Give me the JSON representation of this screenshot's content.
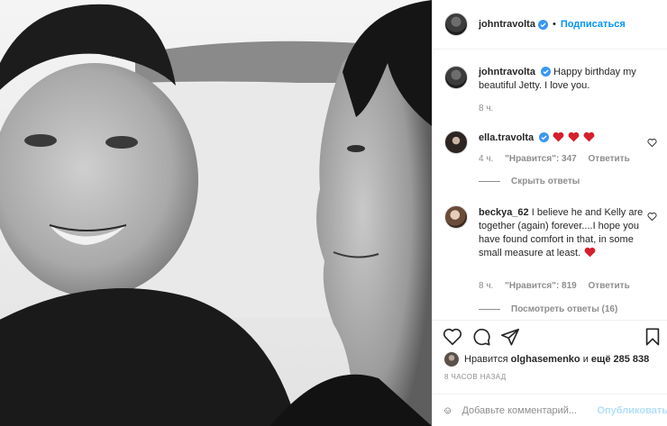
{
  "post": {
    "author": "johntravolta",
    "follow_label": "Подписаться",
    "separator": "•",
    "caption": "Happy birthday my beautiful Jetty. I love you.",
    "caption_time": "8 ч."
  },
  "comments": [
    {
      "username": "ella.travolta",
      "text": "",
      "time": "4 ч.",
      "likes": "\"Нравится\": 347",
      "reply_label": "Ответить",
      "replies_toggle": "Скрыть ответы"
    },
    {
      "username": "beckya_62",
      "text": "I believe he and Kelly are together (again) forever....I hope you have found comfort in that, in some small measure at least.",
      "time": "8 ч.",
      "likes": "\"Нравится\": 819",
      "reply_label": "Ответить",
      "replies_toggle": "Посмотреть ответы (16)"
    }
  ],
  "likes_bar": {
    "prefix": "Нравится",
    "user": "olghasemenko",
    "middle": "и",
    "count": "ещё 285 838"
  },
  "timestamp": "8 ЧАСОВ НАЗАД",
  "comment_input": {
    "placeholder": "Добавьте комментарий...",
    "submit_label": "Опубликовать"
  },
  "icons": [
    "verified-badge-icon",
    "heart-icon",
    "comment-icon",
    "share-icon",
    "bookmark-icon",
    "emoji-icon"
  ],
  "colors": {
    "accent": "#0095f6",
    "muted": "#8e8e8e",
    "heart_red": "#ed4956",
    "disabled_post": "#b2dffc"
  }
}
